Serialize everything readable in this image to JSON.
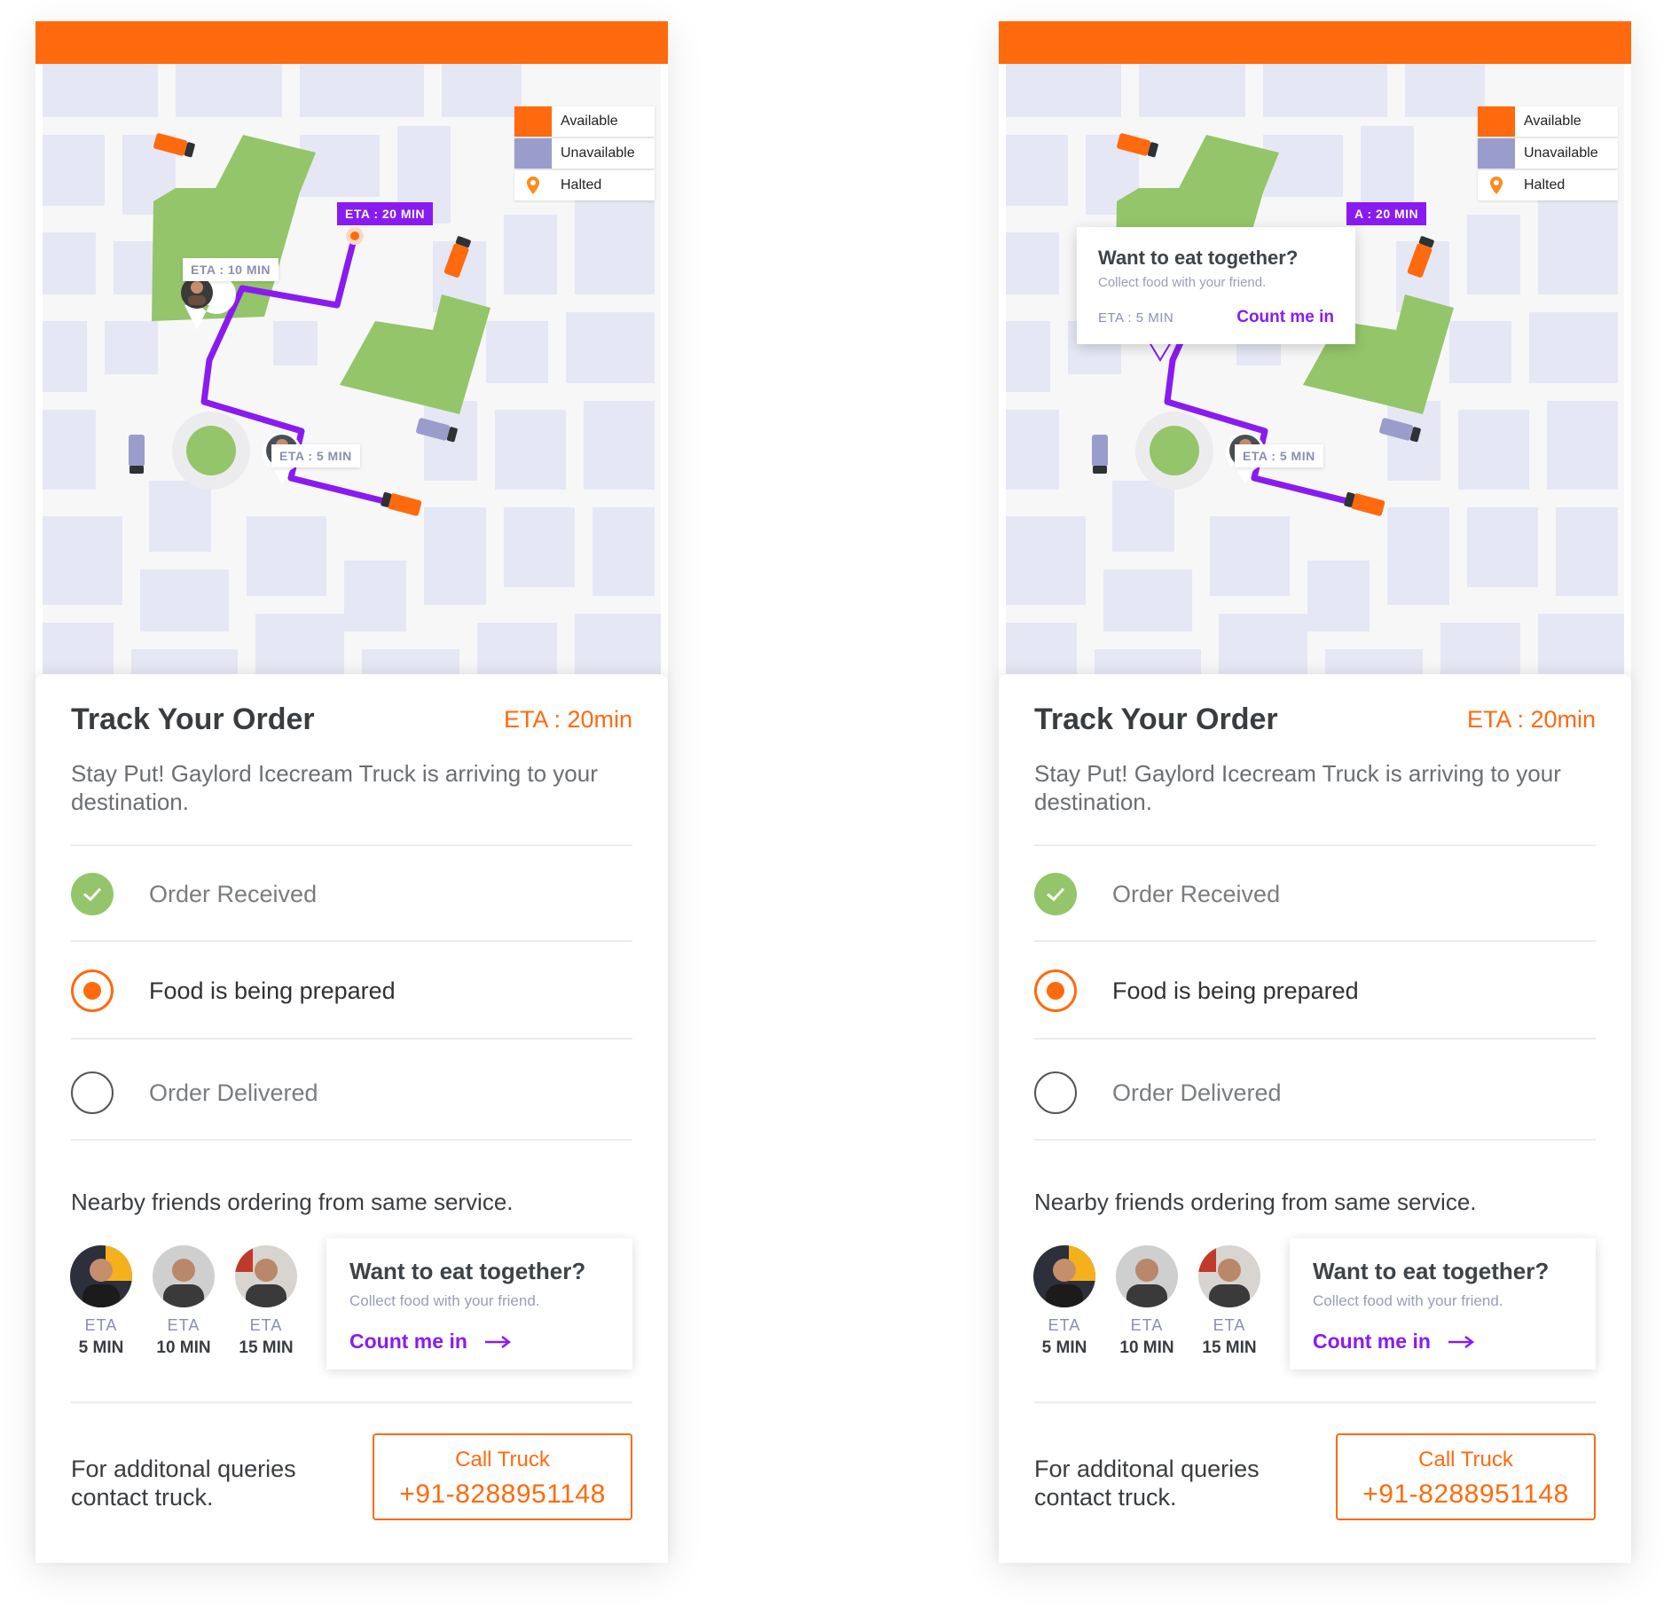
{
  "colors": {
    "brand_orange": "#FF6A0E",
    "accent_purple": "#8A1BF0",
    "done_green": "#94C56A",
    "unavailable_slate": "#9A9DCB",
    "map_block": "#E6E7F5",
    "park_green": "#94C56A"
  },
  "legend": [
    {
      "label": "Available",
      "icon": "orange-square-icon"
    },
    {
      "label": "Unavailable",
      "icon": "slate-square-icon"
    },
    {
      "label": "Halted",
      "icon": "swiggy-pin-icon"
    }
  ],
  "map": {
    "eta_main": "ETA : 20 MIN",
    "eta_main_clipped": "A : 20 MIN",
    "eta_friend_a": "ETA : 10 MIN",
    "eta_friend_b": "ETA : 5 MIN"
  },
  "popup": {
    "title": "Want to eat together?",
    "subtitle": "Collect food with your friend.",
    "eta": "ETA : 5 MIN",
    "cta": "Count me in"
  },
  "card": {
    "title": "Track Your Order",
    "eta": "ETA : 20min",
    "description": "Stay Put! Gaylord Icecream Truck is arriving to your destination."
  },
  "steps": [
    {
      "label": "Order Received",
      "state": "done"
    },
    {
      "label": "Food is being prepared",
      "state": "active"
    },
    {
      "label": "Order Delivered",
      "state": "pending"
    }
  ],
  "friends": {
    "title": "Nearby friends ordering from same service.",
    "eta_label": "ETA",
    "items": [
      {
        "minutes": "5 MIN"
      },
      {
        "minutes": "10 MIN"
      },
      {
        "minutes": "15 MIN"
      }
    ]
  },
  "invite": {
    "title": "Want to eat together?",
    "subtitle": "Collect food with your friend.",
    "cta": "Count me in"
  },
  "contact": {
    "text": "For additonal queries contact truck.",
    "button_label": "Call Truck",
    "phone": "+91-8288951148"
  }
}
